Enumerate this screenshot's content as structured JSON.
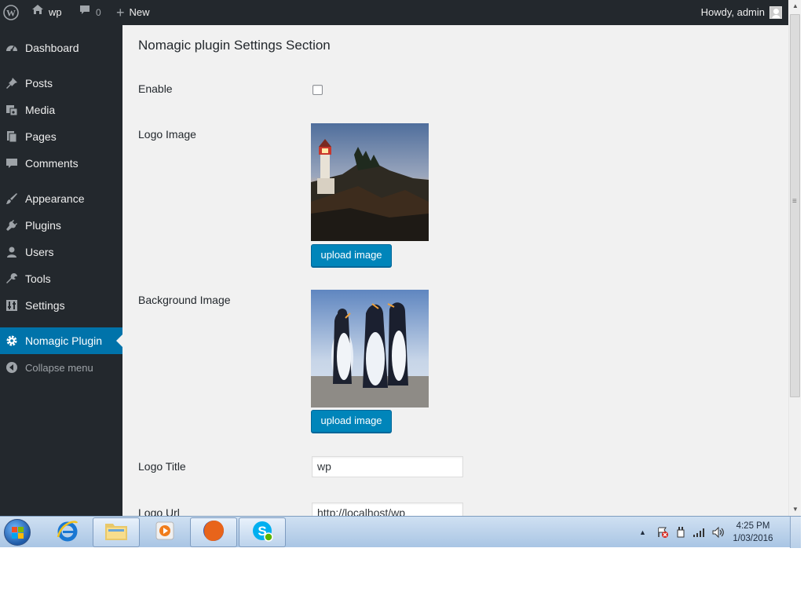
{
  "admin_bar": {
    "site_name": "wp",
    "comment_count": "0",
    "new_label": "New",
    "howdy": "Howdy, admin"
  },
  "sidebar": {
    "items": [
      {
        "label": "Dashboard",
        "icon": "dashboard-icon"
      },
      {
        "label": "Posts",
        "icon": "pin-icon"
      },
      {
        "label": "Media",
        "icon": "media-icon"
      },
      {
        "label": "Pages",
        "icon": "pages-icon"
      },
      {
        "label": "Comments",
        "icon": "comment-icon"
      },
      {
        "label": "Appearance",
        "icon": "brush-icon"
      },
      {
        "label": "Plugins",
        "icon": "plug-icon"
      },
      {
        "label": "Users",
        "icon": "user-icon"
      },
      {
        "label": "Tools",
        "icon": "wrench-icon"
      },
      {
        "label": "Settings",
        "icon": "settings-icon"
      },
      {
        "label": "Nomagic Plugin",
        "icon": "gear-icon",
        "current": true
      }
    ],
    "collapse_label": "Collapse menu"
  },
  "main": {
    "section_title": "Nomagic plugin Settings Section",
    "fields": {
      "enable_label": "Enable",
      "enable_checked": false,
      "logo_image_label": "Logo Image",
      "logo_upload_label": "upload image",
      "background_image_label": "Background Image",
      "background_upload_label": "upload image",
      "logo_title_label": "Logo Title",
      "logo_title_value": "wp",
      "logo_url_label": "Logo Url",
      "logo_url_value": "http://localhost/wp"
    }
  },
  "taskbar": {
    "time": "4:25 PM",
    "date": "1/03/2016"
  },
  "colors": {
    "admin_bar": "#23282d",
    "accent": "#0073aa",
    "button": "#0085ba",
    "content_bg": "#f1f1f1"
  }
}
